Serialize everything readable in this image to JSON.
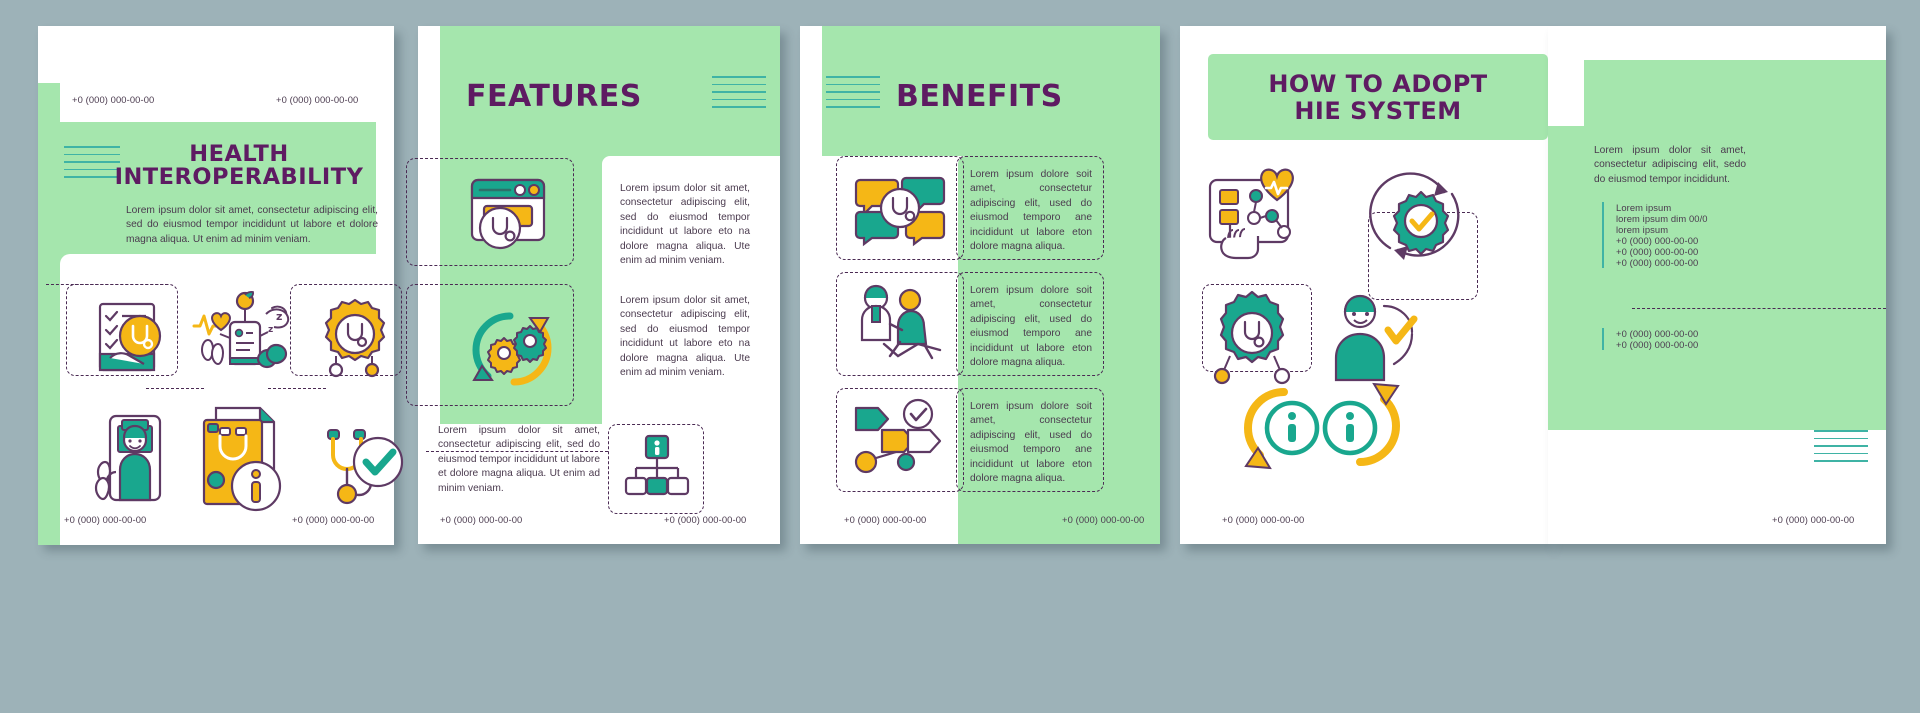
{
  "meta": {
    "colors": {
      "mint": "#a5e6ad",
      "purple": "#5e1b62",
      "teal": "#19a78e",
      "yellow": "#f5b716",
      "body_text": "#4a3a4e",
      "background": "#9db2b8"
    }
  },
  "panel1": {
    "phone_top_left": "+0 (000) 000-00-00",
    "phone_top_right": "+0 (000) 000-00-00",
    "title_line1": "HEALTH",
    "title_line2": "INTEROPERABILITY",
    "paragraph": "Lorem ipsum dolor sit amet, consectetur adipiscing elit, sed do eiusmod tempor incididunt ut labore et dolore magna aliqua. Ut enim ad minim veniam.",
    "phone_bottom_left": "+0 (000) 000-00-00",
    "phone_bottom_right": "+0 (000) 000-00-00",
    "icons": [
      "checklist-stethoscope-icon",
      "wellness-tracker-icon",
      "gear-stethoscope-network-icon",
      "mobile-doctor-icon",
      "medical-record-info-icon",
      "stethoscope-check-icon"
    ]
  },
  "panel2": {
    "title": "FEATURES",
    "paragraph1": "Lorem ipsum dolor sit amet, consectetur adipiscing elit, sed do eiusmod tempor incididunt ut labore eto na dolore magna aliqua. Ute enim ad minim veniam.",
    "paragraph2": "Lorem ipsum dolor sit amet, consectetur adipiscing elit, sed do eiusmod tempor incididunt ut labore eto na dolore magna aliqua. Ute enim ad minim veniam.",
    "paragraph3": "Lorem ipsum dolor sit amet, consectetur adipiscing elit, sed do eiusmod tempor incididunt ut labore et dolore magna aliqua. Ut enim ad minim veniam.",
    "phone_bottom_left": "+0 (000) 000-00-00",
    "phone_bottom_right": "+0 (000) 000-00-00",
    "icons": [
      "browser-stethoscope-icon",
      "sync-gears-icon",
      "hierarchy-info-icon"
    ]
  },
  "panel3": {
    "title": "BENEFITS",
    "items": [
      {
        "icon": "chat-stethoscope-icon",
        "text": "Lorem ipsum dolore soit amet, consectetur adipiscing elit, used do eiusmod temporo ane incididunt ut labore eton dolore magna aliqua."
      },
      {
        "icon": "doctor-patient-icon",
        "text": "Lorem ipsum dolore soit amet, consectetur adipiscing elit, used do eiusmod temporo ane incididunt ut labore eton dolore magna aliqua."
      },
      {
        "icon": "workflow-check-icon",
        "text": "Lorem ipsum dolore soit amet, consectetur adipiscing elit, used do eiusmod temporo ane incididunt ut labore eton dolore magna aliqua."
      }
    ],
    "phone_bottom_left": "+0 (000) 000-00-00",
    "phone_bottom_right": "+0 (000) 000-00-00"
  },
  "panel4": {
    "title_line1": "HOW TO ADOPT",
    "title_line2": "HIE SYSTEM",
    "paragraph": "Lorem ipsum dolor sit amet, consectetur adipiscing elit, sedo do eiusmod tempor incididunt.",
    "contact_block_1": [
      "Lorem ipsum",
      "lorem ipsum dim 00/0",
      "lorem ipsum",
      "+0 (000) 000-00-00",
      "+0 (000) 000-00-00",
      "+0 (000) 000-00-00"
    ],
    "contact_block_2": [
      "+0 (000) 000-00-00",
      "+0 (000) 000-00-00"
    ],
    "phone_bottom_left": "+0 (000) 000-00-00",
    "phone_bottom_right": "+0 (000) 000-00-00",
    "icons": [
      "dashboard-heart-icon",
      "gear-check-sync-icon",
      "gear-stethoscope-network-icon",
      "person-check-icon",
      "info-exchange-icon"
    ]
  }
}
